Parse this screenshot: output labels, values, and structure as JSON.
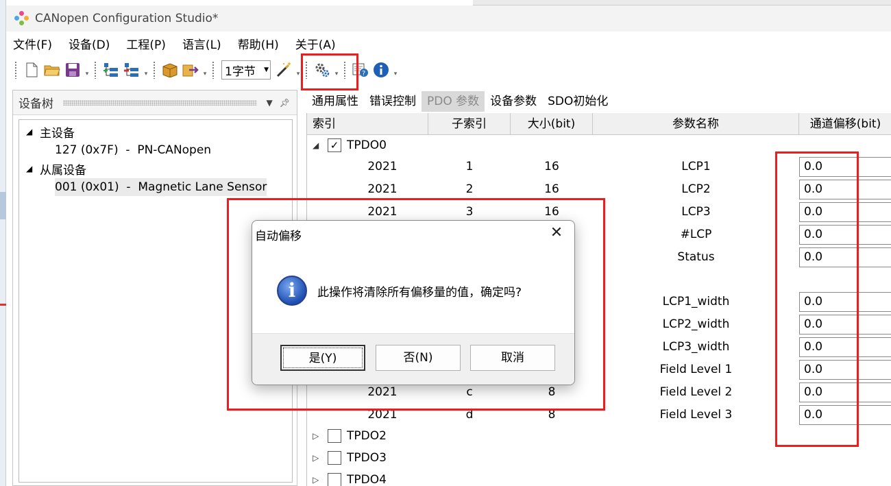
{
  "window": {
    "title": "CANopen Configuration Studio*"
  },
  "menu": [
    "文件(F)",
    "设备(D)",
    "工程(P)",
    "语言(L)",
    "帮助(H)",
    "关于(A)"
  ],
  "toolbar": {
    "size_select": "1字节",
    "icons": [
      "new-file-icon",
      "open-folder-icon",
      "save-icon",
      "add-node-icon",
      "remove-node-icon",
      "package-icon",
      "export-icon",
      "auto-offset-wand-icon",
      "settings-gear-icon",
      "help-icon",
      "info-icon"
    ]
  },
  "device_tree": {
    "title": "设备树",
    "master_label": "主设备",
    "master_node": "127 (0x7F)  -  PN-CANopen",
    "slave_label": "从属设备",
    "slave_node": "001 (0x01)  -  Magnetic Lane Sensor"
  },
  "tabs": [
    "通用属性",
    "错误控制",
    "PDO 参数",
    "设备参数",
    "SDO初始化"
  ],
  "active_tab": "PDO 参数",
  "grid": {
    "columns": [
      "索引",
      "子索引",
      "大小(bit)",
      "参数名称",
      "通道偏移(bit)"
    ],
    "group_open": "TPDO0",
    "rows": [
      {
        "index": "2021",
        "sub": "1",
        "size": "16",
        "name": "LCP1",
        "offset": "0.0"
      },
      {
        "index": "2021",
        "sub": "2",
        "size": "16",
        "name": "LCP2",
        "offset": "0.0"
      },
      {
        "index": "2021",
        "sub": "3",
        "size": "16",
        "name": "LCP3",
        "offset": "0.0"
      },
      {
        "index": "",
        "sub": "",
        "size": "",
        "name": "#LCP",
        "offset": "0.0"
      },
      {
        "index": "",
        "sub": "",
        "size": "",
        "name": "Status",
        "offset": "0.0"
      },
      {
        "index": "",
        "sub": "",
        "size": "",
        "name": "LCP1_width",
        "offset": "0.0"
      },
      {
        "index": "",
        "sub": "",
        "size": "",
        "name": "LCP2_width",
        "offset": "0.0"
      },
      {
        "index": "",
        "sub": "",
        "size": "",
        "name": "LCP3_width",
        "offset": "0.0"
      },
      {
        "index": "",
        "sub": "",
        "size": "",
        "name": "Field Level 1",
        "offset": "0.0"
      },
      {
        "index": "2021",
        "sub": "c",
        "size": "8",
        "name": "Field Level 2",
        "offset": "0.0"
      },
      {
        "index": "2021",
        "sub": "d",
        "size": "8",
        "name": "Field Level 3",
        "offset": "0.0"
      }
    ],
    "groups_closed": [
      "TPDO2",
      "TPDO3",
      "TPDO4"
    ]
  },
  "dialog": {
    "title": "自动偏移",
    "message": "此操作将清除所有偏移量的值，确定吗?",
    "yes": "是(Y)",
    "no": "否(N)",
    "cancel": "取消"
  },
  "colors": {
    "highlight_box": "#ee1c1c",
    "active_tab_bg": "#d9d9d9"
  }
}
